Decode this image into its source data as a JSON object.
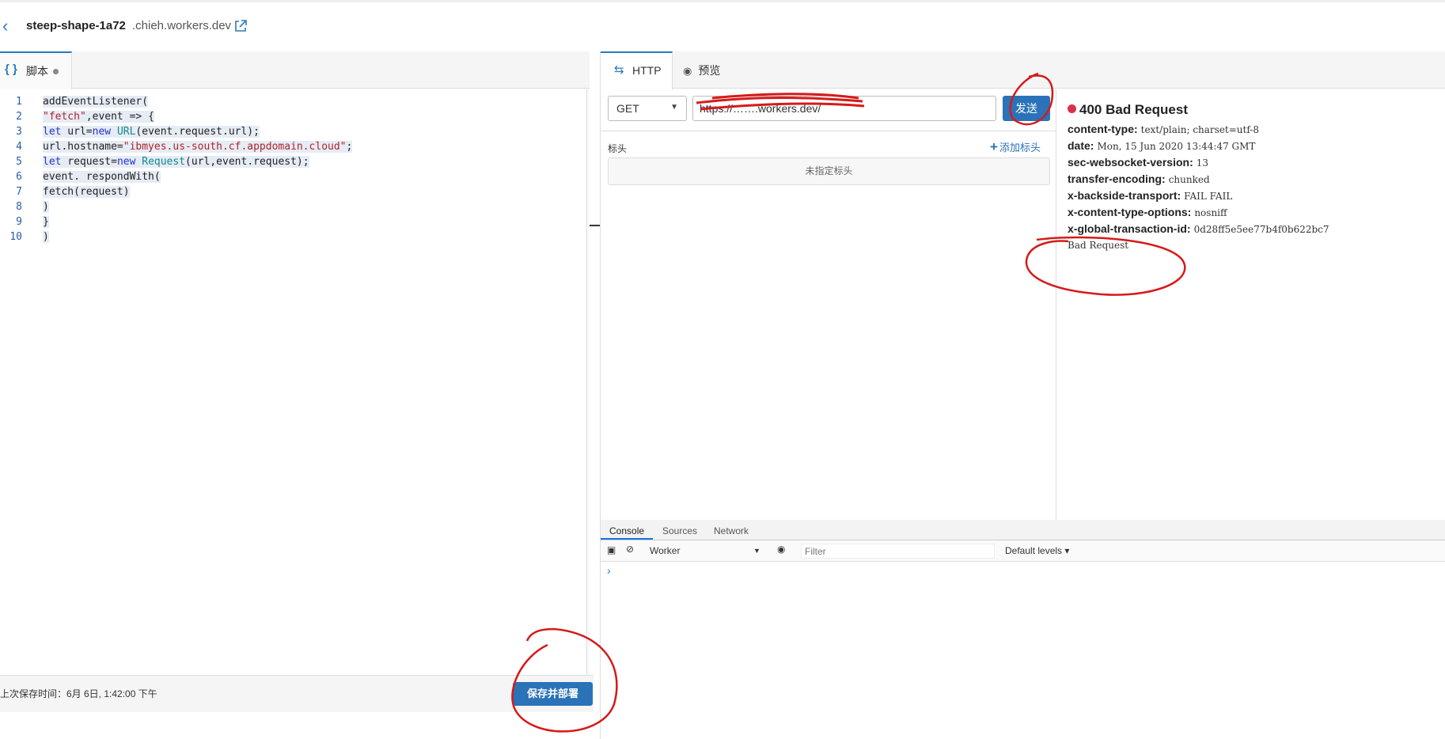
{
  "header": {
    "worker_name": "steep-shape-1a72",
    "domain": ".chieh.workers.dev"
  },
  "editor": {
    "tab_label": "脚本",
    "line_numbers": [
      "1",
      "2",
      "3",
      "4",
      "5",
      "6",
      "7",
      "8",
      "9",
      "10"
    ],
    "lines": [
      [
        {
          "t": "addEventListener(",
          "c": ""
        }
      ],
      [
        {
          "t": "\"fetch\"",
          "c": "str"
        },
        {
          "t": ",event => {",
          "c": ""
        }
      ],
      [
        {
          "t": "let",
          "c": "kw"
        },
        {
          "t": " url=",
          "c": ""
        },
        {
          "t": "new",
          "c": "kw"
        },
        {
          "t": " ",
          "c": ""
        },
        {
          "t": "URL",
          "c": "cls"
        },
        {
          "t": "(event.request.url);",
          "c": ""
        }
      ],
      [
        {
          "t": "url.hostname=",
          "c": ""
        },
        {
          "t": "\"ibmyes.us-south.cf.appdomain.cloud\"",
          "c": "str"
        },
        {
          "t": ";",
          "c": ""
        }
      ],
      [
        {
          "t": "let",
          "c": "kw"
        },
        {
          "t": " request=",
          "c": ""
        },
        {
          "t": "new",
          "c": "kw"
        },
        {
          "t": " ",
          "c": ""
        },
        {
          "t": "Request",
          "c": "cls"
        },
        {
          "t": "(url,event.request);",
          "c": ""
        }
      ],
      [
        {
          "t": "event. respondWith(",
          "c": ""
        }
      ],
      [
        {
          "t": "fetch(request)",
          "c": ""
        }
      ],
      [
        {
          "t": ")",
          "c": ""
        }
      ],
      [
        {
          "t": "}",
          "c": ""
        }
      ],
      [
        {
          "t": ")",
          "c": ""
        }
      ]
    ],
    "last_saved": "上次保存时间：6月 6日, 1:42:00 下午",
    "deploy_label": "保存并部署"
  },
  "http": {
    "tab_http": "HTTP",
    "tab_preview": "预览",
    "method": "GET",
    "url": "https://…….workers.dev/",
    "send_label": "发送",
    "headers_label": "标头",
    "add_header_label": "添加标头",
    "no_headers_label": "未指定标头"
  },
  "response": {
    "status": "400 Bad Request",
    "status_color": "#d8324a",
    "headers": [
      {
        "k": "content-type:",
        "v": "text/plain; charset=utf-8"
      },
      {
        "k": "date:",
        "v": "Mon, 15 Jun 2020 13:44:47 GMT"
      },
      {
        "k": "sec-websocket-version:",
        "v": "13"
      },
      {
        "k": "transfer-encoding:",
        "v": "chunked"
      },
      {
        "k": "x-backside-transport:",
        "v": "FAIL FAIL"
      },
      {
        "k": "x-content-type-options:",
        "v": "nosniff"
      },
      {
        "k": "x-global-transaction-id:",
        "v": "0d28ff5e5ee77b4f0b622bc7"
      }
    ],
    "body": "Bad Request"
  },
  "devtools": {
    "tabs": [
      "Console",
      "Sources",
      "Network"
    ],
    "context": "Worker",
    "filter_placeholder": "Filter",
    "levels": "Default levels ▾",
    "prompt": "›"
  }
}
